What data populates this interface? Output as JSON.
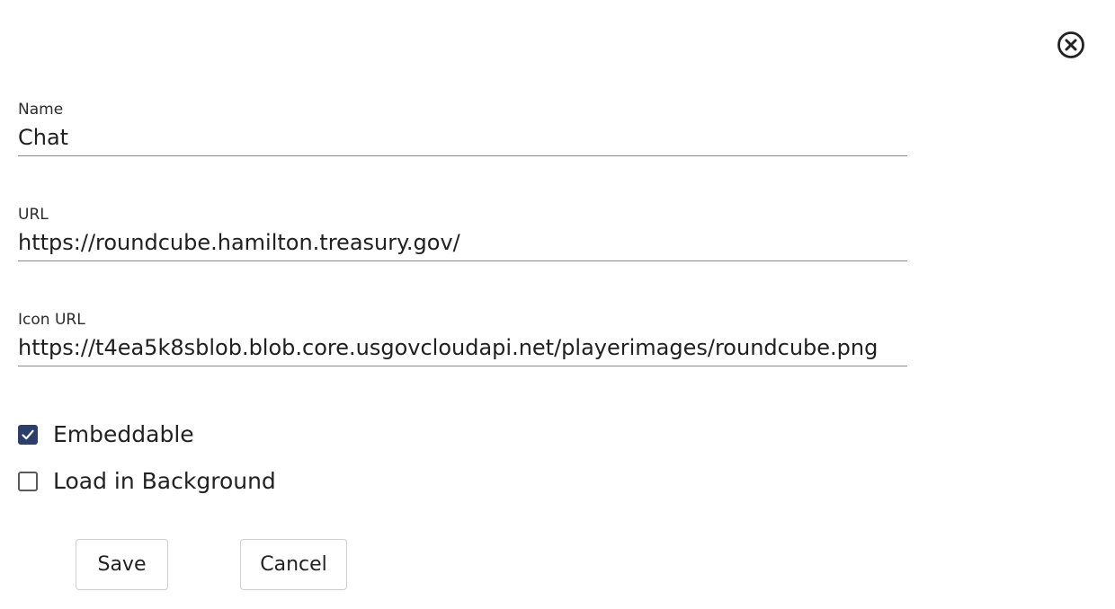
{
  "dialog": {
    "close_icon": "close-circle-icon"
  },
  "fields": {
    "name": {
      "label": "Name",
      "value": "Chat"
    },
    "url": {
      "label": "URL",
      "value": "https://roundcube.hamilton.treasury.gov/"
    },
    "icon_url": {
      "label": "Icon URL",
      "value": "https://t4ea5k8sblob.blob.core.usgovcloudapi.net/playerimages/roundcube.png"
    }
  },
  "options": {
    "embeddable": {
      "label": "Embeddable",
      "checked": true
    },
    "load_in_background": {
      "label": "Load in Background",
      "checked": false
    }
  },
  "actions": {
    "save_label": "Save",
    "cancel_label": "Cancel"
  },
  "colors": {
    "checkbox_checked": "#2c3e6b",
    "underline": "#8a8a8a"
  }
}
